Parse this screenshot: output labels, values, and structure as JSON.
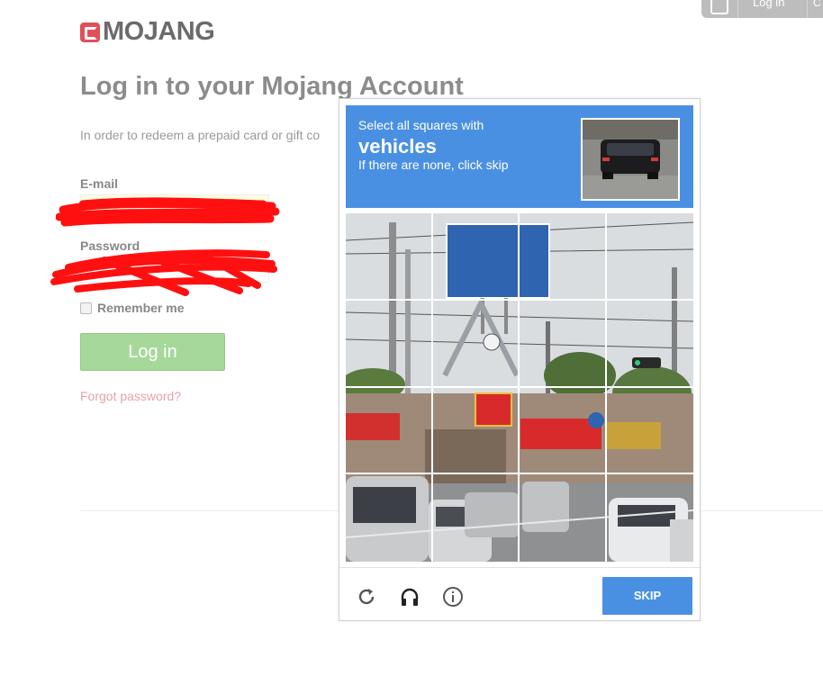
{
  "header": {
    "login_label": "Log in",
    "more_label": "C"
  },
  "brand": {
    "name": "MOJANG",
    "accent": "#e1505a"
  },
  "page": {
    "title": "Log in to your Mojang Account",
    "intro": "In order to redeem a prepaid card or gift co"
  },
  "form": {
    "email_label": "E-mail",
    "email_value": "",
    "password_label": "Password",
    "password_value": "",
    "remember_label": "Remember me",
    "login_button": "Log in",
    "forgot_link": "Forgot password?"
  },
  "captcha": {
    "instruction_line1": "Select all squares with",
    "instruction_target": "vehicles",
    "instruction_line3": "If there are none, click skip",
    "skip_button": "SKIP",
    "footer_icons": [
      "reload-icon",
      "audio-icon",
      "info-icon"
    ],
    "header_color": "#4a90e2"
  }
}
